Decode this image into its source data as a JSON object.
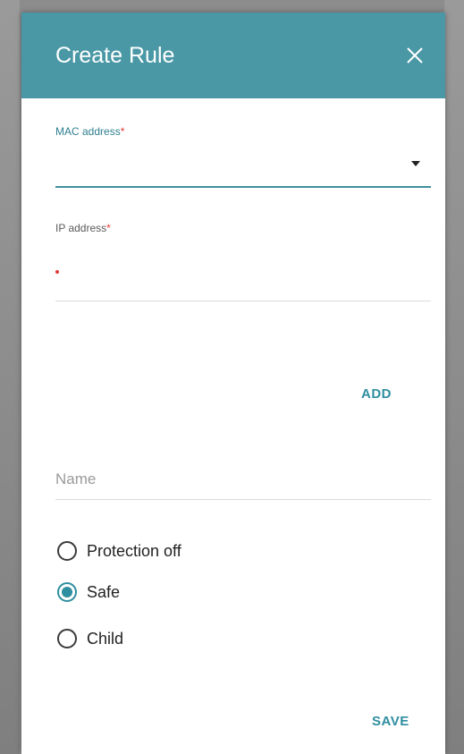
{
  "dialog": {
    "title": "Create Rule",
    "close_icon": "close-icon"
  },
  "mac": {
    "label": "MAC address",
    "required_mark": "*",
    "value": "",
    "dropdown_icon": "caret-down-icon"
  },
  "ip": {
    "label": "IP address",
    "required_mark": "*",
    "value": ""
  },
  "add_label": "ADD",
  "name": {
    "placeholder": "Name",
    "value": ""
  },
  "protection": {
    "options": [
      {
        "label": "Protection off",
        "checked": false
      },
      {
        "label": "Safe",
        "checked": true
      },
      {
        "label": "Child",
        "checked": false
      }
    ]
  },
  "save_label": "SAVE",
  "colors": {
    "header": "#4a98a6",
    "accent": "#2f8ea0",
    "required": "#e53935"
  }
}
